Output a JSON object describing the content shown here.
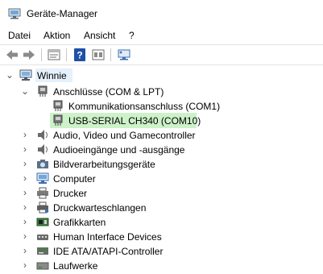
{
  "window": {
    "title": "Geräte-Manager"
  },
  "menu": [
    "Datei",
    "Aktion",
    "Ansicht",
    "?"
  ],
  "tree": {
    "root": "Winnie",
    "ports": {
      "label": "Anschlüsse (COM & LPT)",
      "children": [
        "Kommunikationsanschluss (COM1)",
        "USB-SERIAL CH340 (COM10)"
      ]
    },
    "categories": [
      "Audio, Video und Gamecontroller",
      "Audioeingänge und -ausgänge",
      "Bildverarbeitungsgeräte",
      "Computer",
      "Drucker",
      "Druckwarteschlangen",
      "Grafikkarten",
      "Human Interface Devices",
      "IDE ATA/ATAPI-Controller",
      "Laufwerke"
    ]
  },
  "colors": {
    "highlight": "#cdf1c8",
    "selection": "#e5f1fb"
  }
}
